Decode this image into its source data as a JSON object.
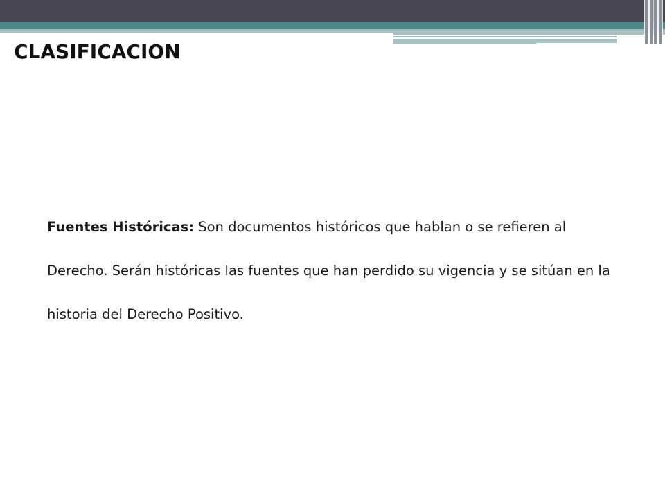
{
  "slide": {
    "title": "CLASIFICACION",
    "paragraph": {
      "term": "Fuentes Históricas:",
      "text": " Son documentos históricos que hablan o se refieren al Derecho. Serán históricas las fuentes que han perdido su vigencia y se sitúan en la historia del Derecho Positivo."
    }
  },
  "colors": {
    "dark_band": "#464655",
    "teal_band": "#4e8787",
    "light_band": "#a7c0c2",
    "background": "#ffffff",
    "text": "#1a1a1a"
  }
}
